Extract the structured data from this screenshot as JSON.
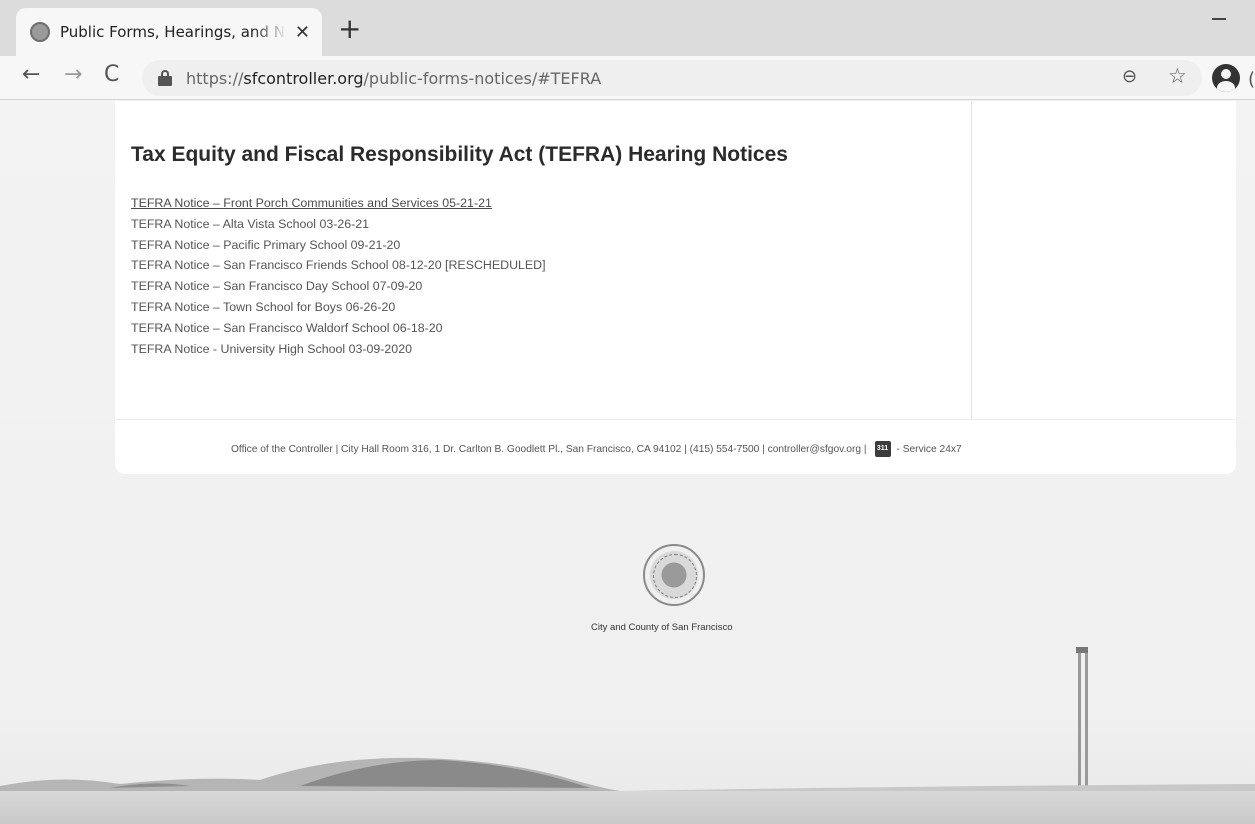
{
  "browser": {
    "tab_title": "Public Forms, Hearings, and Notices",
    "tab_close": "✕",
    "new_tab": "+",
    "nav": {
      "back": "←",
      "forward": "→",
      "reload": "C"
    },
    "url_scheme": "https://",
    "url_host": "sfcontroller.org",
    "url_path": "/public-forms-notices/#TEFRA",
    "zoom_glyph": "⊖",
    "star_glyph": "☆",
    "profile_edge": "("
  },
  "page": {
    "title": "Tax Equity and Fiscal Responsibility Act (TEFRA) Hearing Notices",
    "notices": [
      "TEFRA Notice – Front Porch Communities and Services 05-21-21",
      "TEFRA Notice – Alta Vista School 03-26-21",
      "TEFRA Notice – Pacific Primary School 09-21-20",
      "TEFRA Notice – San Francisco Friends School 08-12-20 [RESCHEDULED]",
      "TEFRA Notice – San Francisco Day School 07-09-20",
      "TEFRA Notice – Town School for Boys 06-26-20",
      "TEFRA Notice – San Francisco Waldorf School 06-18-20",
      "TEFRA Notice - University High School 03-09-2020"
    ],
    "footer": {
      "address": "Office of the Controller | City Hall Room 316, 1 Dr. Carlton B. Goodlett Pl., San Francisco, CA 94102 | (415) 554-7500 | controller@sfgov.org |",
      "badge_311": "311",
      "service": "- Service 24x7"
    },
    "seal_caption": "City and County of San Francisco"
  }
}
